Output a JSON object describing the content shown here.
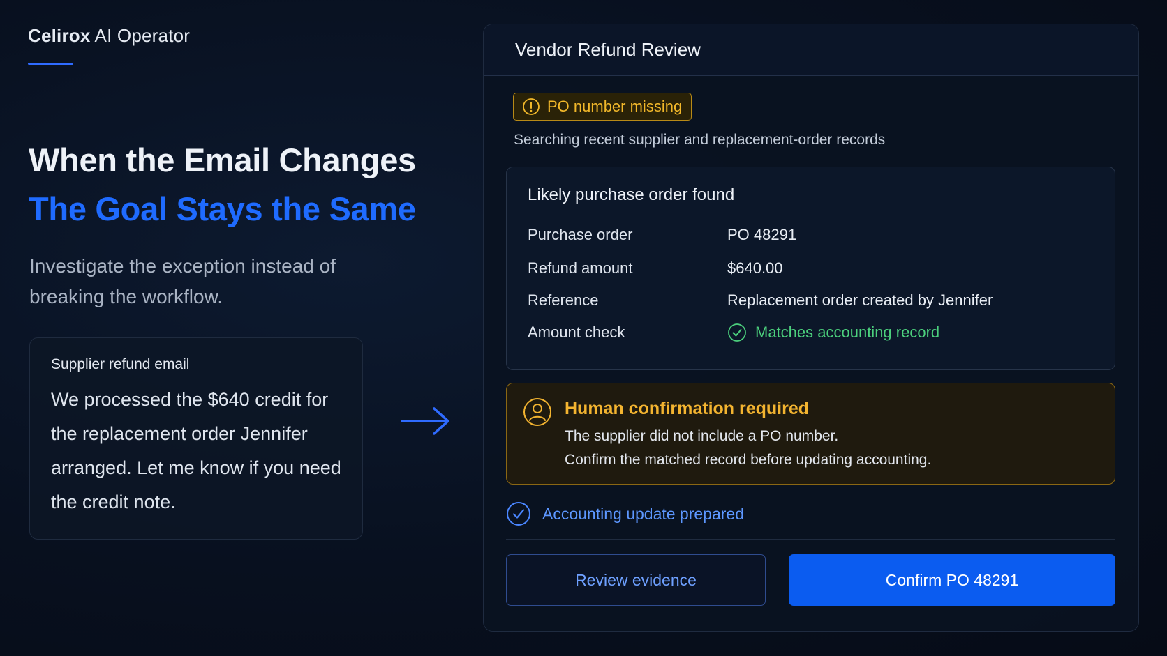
{
  "brand": {
    "name_bold": "Celirox",
    "name_rest": "AI Operator"
  },
  "hero": {
    "headline": "When the Email Changes",
    "headline_accent": "The Goal Stays the Same",
    "subcopy": "Investigate the exception instead of breaking the workflow."
  },
  "email": {
    "label": "Supplier refund email",
    "body": "We processed the $640 credit for the replacement order Jennifer arranged. Let me know if you need the credit note."
  },
  "panel": {
    "title": "Vendor Refund Review",
    "badge": "PO number missing",
    "searching": "Searching recent supplier and replacement-order records",
    "po_card": {
      "title": "Likely purchase order found",
      "rows": [
        {
          "key": "Purchase order",
          "value": "PO 48291"
        },
        {
          "key": "Refund amount",
          "value": "$640.00"
        },
        {
          "key": "Reference",
          "value": "Replacement order created by Jennifer"
        },
        {
          "key": "Amount check",
          "value": "Matches accounting record"
        }
      ]
    },
    "confirmation": {
      "title": "Human confirmation required",
      "line1": "The supplier did not include a PO number.",
      "line2": "Confirm the matched record before updating accounting."
    },
    "prepared": "Accounting update prepared",
    "buttons": {
      "review": "Review evidence",
      "confirm": "Confirm PO 48291"
    }
  },
  "colors": {
    "accent_blue": "#1f6bff",
    "warning_amber": "#f3b430",
    "success_green": "#4cd07d",
    "background": "#08101f"
  },
  "icons": {
    "badge": "alert-circle-icon",
    "amount_check": "check-circle-icon",
    "confirmation": "user-icon",
    "prepared": "check-circle-icon",
    "flow": "arrow-right-icon"
  }
}
